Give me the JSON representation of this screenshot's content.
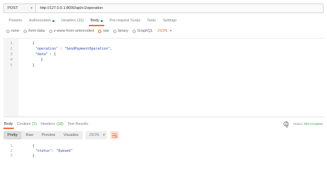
{
  "request": {
    "method": "POST",
    "url": "http://127.0.0.1:8000/api/v1/operation"
  },
  "request_tabs": [
    {
      "label": "Params"
    },
    {
      "label": "Authorization",
      "indicator": "dot"
    },
    {
      "label": "Headers",
      "count": "(11)"
    },
    {
      "label": "Body",
      "indicator": "dot",
      "active": true
    },
    {
      "label": "Pre-request Script"
    },
    {
      "label": "Tests"
    },
    {
      "label": "Settings"
    }
  ],
  "body_types": {
    "none": "none",
    "form_data": "form-data",
    "urlencoded": "x-www-form-urlencoded",
    "raw": "raw",
    "binary": "binary",
    "graphql": "GraphQL",
    "format": "JSON",
    "selected": "raw"
  },
  "request_body": {
    "line_numbers": [
      "1",
      "2",
      "3",
      "4",
      "5"
    ],
    "open_brace": "{",
    "operation_key": "\"operation\"",
    "operation_value": "\"SendPaymentOperation\"",
    "data_key": "\"data\"",
    "colon_open": " : {",
    "inner_close": "}",
    "close_brace": "}",
    "colon": " : ",
    "comma": ","
  },
  "response_tabs": [
    {
      "label": "Body",
      "active": true
    },
    {
      "label": "Cookies",
      "count": "(1)"
    },
    {
      "label": "Headers",
      "count": "(10)"
    },
    {
      "label": "Test Results"
    }
  ],
  "response_status": {
    "label": "Status:",
    "value": "202 Accepted"
  },
  "response_toolbar": {
    "modes": [
      "Pretty",
      "Raw",
      "Preview",
      "Visualize"
    ],
    "active_mode": "Pretty",
    "format": "JSON"
  },
  "response_body": {
    "line_numbers": [
      "1",
      "2",
      "3"
    ],
    "open_brace": "{",
    "status_key": "\"status\"",
    "colon": ": ",
    "status_value": "\"Queued\"",
    "close_brace": "}"
  },
  "icons": {
    "method_dropdown": "chevron-down-icon",
    "globe": "globe-icon",
    "wrap": "wrap-lines-icon"
  },
  "colors": {
    "accent": "#f26b3a",
    "status_ok": "#3a9a3a",
    "json_key": "#2e4bb0"
  }
}
